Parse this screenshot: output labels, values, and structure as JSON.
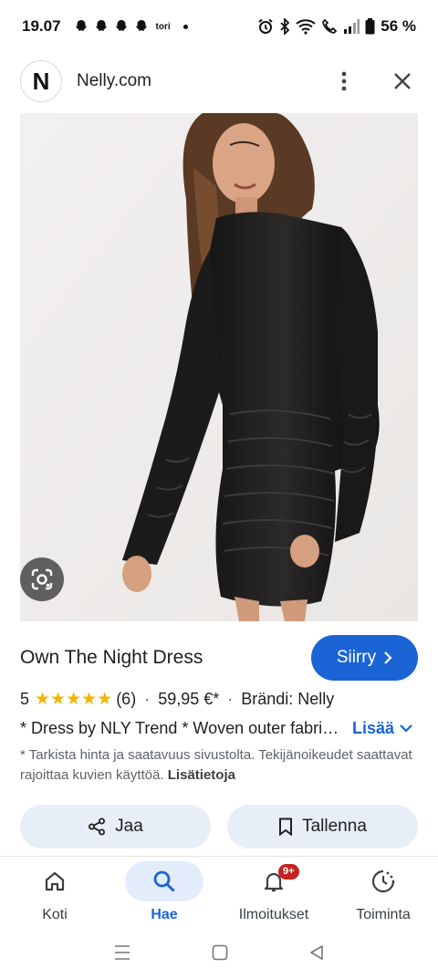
{
  "status_bar": {
    "time": "19.07",
    "notification_label": "tori",
    "battery": "56 %"
  },
  "header": {
    "logo_letter": "N",
    "site_name": "Nelly.com"
  },
  "product": {
    "title": "Own The Night Dress",
    "visit_label": "Siirry",
    "rating_value": "5",
    "stars": "★★★★★",
    "rating_count": "(6)",
    "price": "59,95 €*",
    "brand": "Brändi: Nelly",
    "description": "* Dress by NLY Trend * Woven outer fabric * Round neck * Long sleeves",
    "more_label": "Lisää",
    "disclaimer": "* Tarkista hinta ja saatavuus sivustolta. Tekijänoikeudet saattavat rajoittaa kuvien käyttöä.",
    "disclaimer_link": "Lisätietoja"
  },
  "actions": {
    "share_label": "Jaa",
    "save_label": "Tallenna"
  },
  "bottom_nav": {
    "items": [
      {
        "label": "Koti",
        "icon": "home-icon"
      },
      {
        "label": "Hae",
        "icon": "search-icon",
        "active": true
      },
      {
        "label": "Ilmoitukset",
        "icon": "bell-icon",
        "badge": "9+"
      },
      {
        "label": "Toiminta",
        "icon": "activity-icon"
      }
    ]
  },
  "colors": {
    "accent": "#1a64d6",
    "pill_bg": "#e8eef8",
    "star": "#f4b400",
    "badge": "#c5221f"
  }
}
